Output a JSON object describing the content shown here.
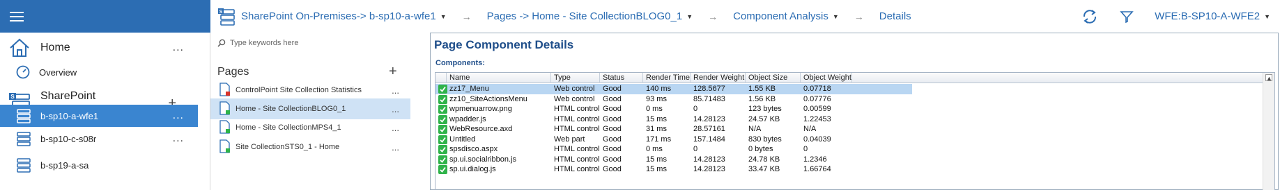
{
  "header": {
    "breadcrumbs": [
      {
        "label": "SharePoint On-Premises-> b-sp10-a-wfe1",
        "has_dropdown": true
      },
      {
        "label": "Pages -> Home - Site CollectionBLOG0_1",
        "has_dropdown": true
      },
      {
        "label": "Component Analysis",
        "has_dropdown": true
      },
      {
        "label": "Details",
        "has_dropdown": false
      }
    ],
    "server_label": "WFE:B-SP10-A-WFE2",
    "accent": "#2c6db3"
  },
  "sidebar": {
    "home": {
      "label": "Home",
      "more": "..."
    },
    "overview": {
      "label": "Overview"
    },
    "sharepoint": {
      "label": "SharePoint\nOn-Premises",
      "add": "+"
    },
    "servers": [
      {
        "label": "b-sp10-a-wfe1",
        "more": "...",
        "selected": true
      },
      {
        "label": "b-sp10-c-s08r",
        "more": "..."
      },
      {
        "label": "b-sp19-a-sa",
        "more": ""
      }
    ]
  },
  "pages_panel": {
    "search_placeholder": "Type keywords here",
    "title": "Pages",
    "add": "+",
    "items": [
      {
        "label": "ControlPoint Site Collection Statistics",
        "more": "...",
        "selected": false,
        "badge": "red"
      },
      {
        "label": "Home - Site CollectionBLOG0_1",
        "more": "...",
        "selected": true,
        "badge": "green"
      },
      {
        "label": "Home - Site CollectionMPS4_1",
        "more": "...",
        "selected": false,
        "badge": "green"
      },
      {
        "label": "Site CollectionSTS0_1 - Home",
        "more": "...",
        "selected": false,
        "badge": "green"
      }
    ]
  },
  "main": {
    "title": "Page Component Details",
    "components_label": "Components:",
    "columns": [
      "Name",
      "Type",
      "Status",
      "Render Time",
      "Render Weight",
      "Object Size",
      "Object Weight"
    ],
    "rows": [
      [
        "zz17_Menu",
        "Web control",
        "Good",
        "140 ms",
        "128.5677",
        "1.55 KB",
        "0.07718"
      ],
      [
        "zz10_SiteActionsMenu",
        "Web control",
        "Good",
        "93 ms",
        "85.71483",
        "1.56 KB",
        "0.07776"
      ],
      [
        "wpmenuarrow.png",
        "HTML control",
        "Good",
        "0 ms",
        "0",
        "123 bytes",
        "0.00599"
      ],
      [
        "wpadder.js",
        "HTML control",
        "Good",
        "15 ms",
        "14.28123",
        "24.57 KB",
        "1.22453"
      ],
      [
        "WebResource.axd",
        "HTML control",
        "Good",
        "31 ms",
        "28.57161",
        "N/A",
        "N/A"
      ],
      [
        "Untitled",
        "Web part",
        "Good",
        "171 ms",
        "157.1484",
        "830 bytes",
        "0.04039"
      ],
      [
        "spsdisco.aspx",
        "HTML control",
        "Good",
        "0 ms",
        "0",
        "0 bytes",
        "0"
      ],
      [
        "sp.ui.socialribbon.js",
        "HTML control",
        "Good",
        "15 ms",
        "14.28123",
        "24.78 KB",
        "1.2346"
      ],
      [
        "sp.ui.dialog.js",
        "HTML control",
        "Good",
        "15 ms",
        "14.28123",
        "33.47 KB",
        "1.66764"
      ]
    ],
    "selected_row": 0,
    "status_color": "#2fb34a"
  }
}
